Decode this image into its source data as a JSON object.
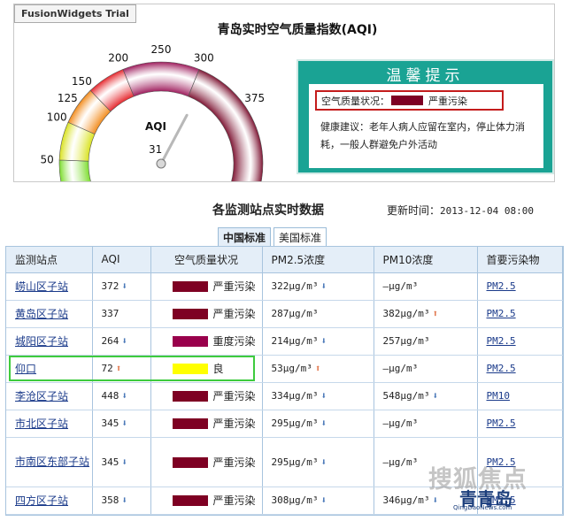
{
  "panel": {
    "trial_label": "FusionWidgets Trial",
    "title": "青岛实时空气质量指数(AQI)"
  },
  "gauge": {
    "label": "AQI",
    "value": 31,
    "value_text": "31",
    "min": 0,
    "max": 500,
    "ticks": [
      "0",
      "50",
      "100",
      "125",
      "150",
      "200",
      "250",
      "300",
      "375",
      "500"
    ],
    "tick_values": [
      0,
      50,
      100,
      125,
      150,
      200,
      250,
      300,
      375,
      500
    ],
    "bands": [
      {
        "from": 0,
        "to": 50,
        "color": "#7cdd2e"
      },
      {
        "from": 50,
        "to": 100,
        "color": "#d9e21f"
      },
      {
        "from": 100,
        "to": 150,
        "color": "#f28b1b"
      },
      {
        "from": 150,
        "to": 200,
        "color": "#e5262c"
      },
      {
        "from": 200,
        "to": 300,
        "color": "#9e1c5c"
      },
      {
        "from": 300,
        "to": 500,
        "color": "#7e1533"
      }
    ]
  },
  "notice": {
    "title": "温馨提示",
    "status_label": "空气质量状况：",
    "status_value": "严重污染",
    "status_color": "#7e0023",
    "advice": "健康建议：老年人病人应留在室内，停止体力消耗，一般人群避免户外活动"
  },
  "table": {
    "title": "各监测站点实时数据",
    "update_label": "更新时间：",
    "update_time": "2013-12-04 08:00",
    "tabs": [
      "中国标准",
      "美国标准"
    ],
    "active_tab": 0,
    "headers": [
      "监测站点",
      "AQI",
      "空气质量状况",
      "PM2.5浓度",
      "PM10浓度",
      "首要污染物"
    ],
    "rows": [
      {
        "station": "崂山区子站",
        "aqi": "372",
        "aqi_trend": "down",
        "quality": "严重污染",
        "color": "#7e0023",
        "pm25": "322μg/m³",
        "pm25_trend": "down",
        "pm10": "—μg/m³",
        "pm10_trend": "",
        "primary": "PM2.5"
      },
      {
        "station": "黄岛区子站",
        "aqi": "337",
        "aqi_trend": "",
        "quality": "严重污染",
        "color": "#7e0023",
        "pm25": "287μg/m³",
        "pm25_trend": "",
        "pm10": "382μg/m³",
        "pm10_trend": "up",
        "primary": "PM2.5"
      },
      {
        "station": "城阳区子站",
        "aqi": "264",
        "aqi_trend": "down",
        "quality": "重度污染",
        "color": "#99004c",
        "pm25": "214μg/m³",
        "pm25_trend": "down",
        "pm10": "257μg/m³",
        "pm10_trend": "",
        "primary": "PM2.5"
      },
      {
        "station": "仰口",
        "aqi": "72",
        "aqi_trend": "up",
        "quality": "良",
        "color": "#ffff00",
        "pm25": "53μg/m³",
        "pm25_trend": "up",
        "pm10": "—μg/m³",
        "pm10_trend": "",
        "primary": "PM2.5"
      },
      {
        "station": "李沧区子站",
        "aqi": "448",
        "aqi_trend": "down",
        "quality": "严重污染",
        "color": "#7e0023",
        "pm25": "334μg/m³",
        "pm25_trend": "down",
        "pm10": "548μg/m³",
        "pm10_trend": "down",
        "primary": "PM10"
      },
      {
        "station": "市北区子站",
        "aqi": "345",
        "aqi_trend": "down",
        "quality": "严重污染",
        "color": "#7e0023",
        "pm25": "295μg/m³",
        "pm25_trend": "down",
        "pm10": "—μg/m³",
        "pm10_trend": "",
        "primary": "PM2.5"
      },
      {
        "station": "市南区东部子站",
        "aqi": "345",
        "aqi_trend": "down",
        "quality": "严重污染",
        "color": "#7e0023",
        "pm25": "295μg/m³",
        "pm25_trend": "down",
        "pm10": "—μg/m³",
        "pm10_trend": "",
        "primary": "PM2.5",
        "tall": true
      },
      {
        "station": "四方区子站",
        "aqi": "358",
        "aqi_trend": "down",
        "quality": "严重污染",
        "color": "#7e0023",
        "pm25": "308μg/m³",
        "pm25_trend": "down",
        "pm10": "346μg/m³",
        "pm10_trend": "down",
        "primary": "PM2.5"
      }
    ]
  },
  "watermark": {
    "line1": "搜狐焦点",
    "line2": "青青岛",
    "line3": "QingDaoNews.com"
  }
}
